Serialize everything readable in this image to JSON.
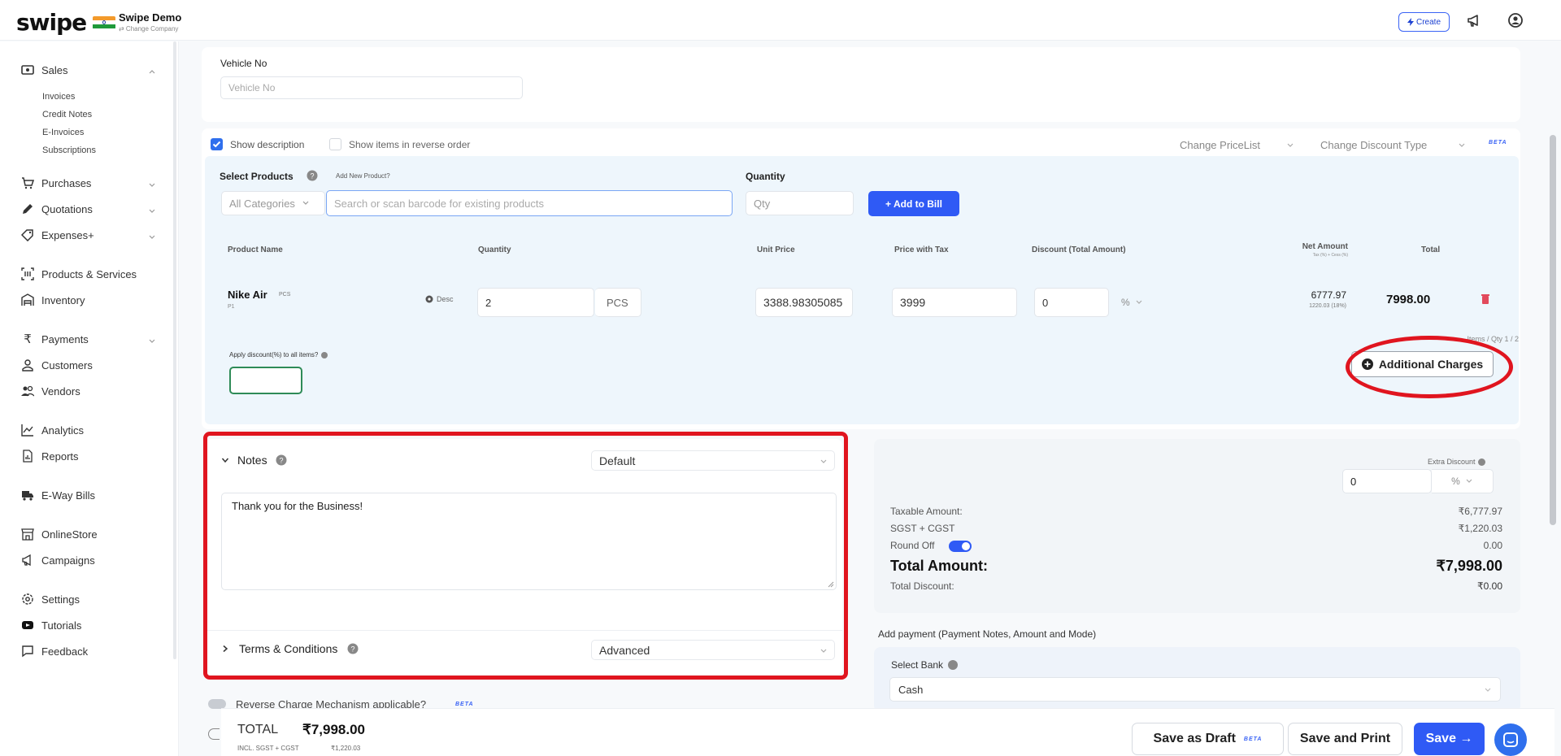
{
  "brand": {
    "name": "swipe",
    "company": "Swipe Demo",
    "company_sub": "⇄ Change Company"
  },
  "topbar": {
    "create": "Create"
  },
  "sidebar": {
    "sales": "Sales",
    "sales_sub": [
      "Invoices",
      "Credit Notes",
      "E-Invoices",
      "Subscriptions"
    ],
    "purchases": "Purchases",
    "quotations": "Quotations",
    "expenses": "Expenses+",
    "products": "Products & Services",
    "inventory": "Inventory",
    "payments": "Payments",
    "customers": "Customers",
    "vendors": "Vendors",
    "analytics": "Analytics",
    "reports": "Reports",
    "eway": "E-Way Bills",
    "onlinestore": "OnlineStore",
    "campaigns": "Campaigns",
    "settings": "Settings",
    "tutorials": "Tutorials",
    "feedback": "Feedback"
  },
  "vehicle": {
    "label": "Vehicle No",
    "placeholder": "Vehicle No"
  },
  "options": {
    "show_description": "Show description",
    "reverse_order": "Show items in reverse order",
    "change_pricelist": "Change PriceList",
    "change_discount": "Change Discount Type",
    "beta": "BETA"
  },
  "select": {
    "label": "Select Products",
    "add_new": "Add New Product?",
    "category": "All Categories",
    "search_placeholder": "Search or scan barcode for existing products",
    "qty_label": "Quantity",
    "qty_placeholder": "Qty",
    "add_to_bill": "+ Add to Bill"
  },
  "table": {
    "headers": {
      "product": "Product Name",
      "quantity": "Quantity",
      "unit_price": "Unit Price",
      "price_tax": "Price with Tax",
      "discount": "Discount (Total Amount)",
      "net_amount": "Net Amount",
      "net_sub": "Tax (%) + Cess (%)",
      "total": "Total"
    },
    "row": {
      "name": "Nike Air",
      "unit": "PCS",
      "code": "P1",
      "desc": "Desc",
      "qty": "2",
      "qty_unit": "PCS",
      "unit_price": "3388.98305085",
      "price_tax": "3999",
      "discount": "0",
      "discount_type": "%",
      "net_amount": "6777.97",
      "net_tax": "1220.03 (18%)",
      "total": "7998.00"
    },
    "items_qty": "Items / Qty 1 / 2",
    "apply_discount": "Apply discount(%) to all items?",
    "additional_charges": "Additional Charges"
  },
  "notes": {
    "title": "Notes",
    "template": "Default",
    "text": "Thank you for the Business!",
    "terms_title": "Terms & Conditions",
    "terms_template": "Advanced",
    "reverse_charge": "Reverse Charge Mechanism applicable?",
    "beta": "BETA"
  },
  "summary": {
    "extra_discount": "Extra Discount",
    "extra_value": "0",
    "extra_type": "%",
    "taxable_label": "Taxable Amount:",
    "taxable_value": "₹6,777.97",
    "tax_label": "SGST + CGST",
    "tax_value": "₹1,220.03",
    "roundoff_label": "Round Off",
    "roundoff_value": "0.00",
    "total_label": "Total Amount:",
    "total_value": "₹7,998.00",
    "total_discount_label": "Total Discount:",
    "total_discount_value": "₹0.00"
  },
  "payment": {
    "heading": "Add payment (Payment Notes, Amount and Mode)",
    "bank_label": "Select Bank",
    "bank_value": "Cash"
  },
  "footer": {
    "total_label": "TOTAL",
    "total_value": "₹7,998.00",
    "incl": "INCL. SGST + CGST",
    "incl_value": "₹1,220.03",
    "save_draft": "Save as Draft",
    "beta": "BETA",
    "save_print": "Save and Print",
    "save": "Save →"
  },
  "colors": {
    "accent": "#2f5af5",
    "annotation": "#e0151f",
    "panel": "#eef6fc"
  }
}
